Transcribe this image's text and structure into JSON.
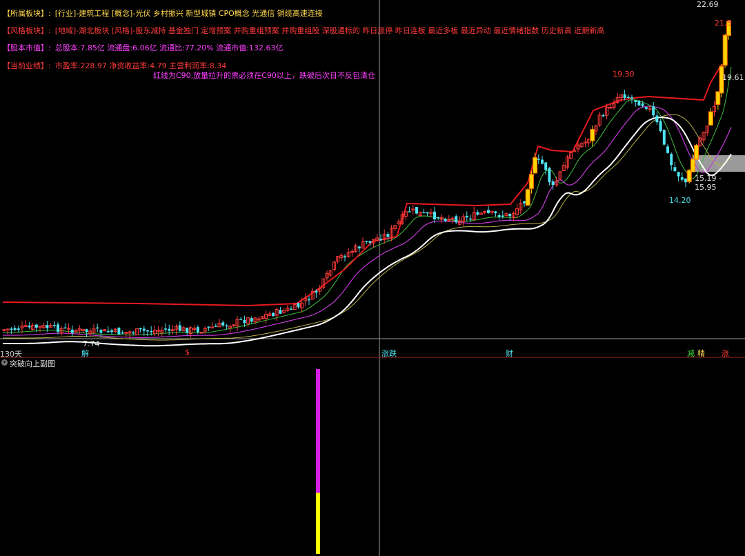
{
  "header": {
    "sector": {
      "label": "【所属板块】:",
      "text": "[行业]-建筑工程 [概念]-光伏 乡村振兴 新型城镇 CPO概念 光通信 铜缆高速连接"
    },
    "style": {
      "label": "【风格板块】:",
      "text": "[地域]-湖北板块 [风格]-股东减持 基金独门 定增预案 并购重组预案 并购重组股 深股通标的 昨日涨停 昨日连板 最近多板 最近异动 最近情绪指数 历史新高 近期新高"
    },
    "capital": {
      "label": "【股本市值】:",
      "text": "总股本:7.85亿 流通盘:6.06亿 流通比:77.20% 流通市值:132.63亿"
    },
    "performance": {
      "label": "【当前业绩】:",
      "text": "市盈率:228.97 净资收益率:4.79 主营利润率:8.34"
    },
    "note": "红线为C90,放量拉升的票必须在C90以上，跌破后次日不反包清仓"
  },
  "price_labels": {
    "last": "22.69",
    "current": "21.5",
    "high_mid": "19.30",
    "ma_value": "19.61",
    "low_right": "14.20",
    "range": "15.19 - 15.95",
    "low_left": "7.74"
  },
  "events": {
    "jie": "解",
    "jin": "$",
    "die": "涨跌",
    "cai": "财",
    "jian": "减",
    "jing": "精",
    "zhang": "涨"
  },
  "period_label": "130天",
  "sub_chart": {
    "title": "突破向上副图",
    "bar_total": 1.0,
    "bar_yellow_fraction": 0.33
  },
  "colors": {
    "background": "#000000",
    "up": "#ff3b3b",
    "down": "#4fe3f0",
    "limit_up": "#ffd400",
    "c90": "#e8191e",
    "ma_white": "#ffffff",
    "ma_magenta": "#c43ad9",
    "ma_yellow": "#b8b04a",
    "ma_green": "#3fbf3f",
    "sub_magenta": "#d21fe0",
    "sub_yellow": "#ffff00"
  }
}
